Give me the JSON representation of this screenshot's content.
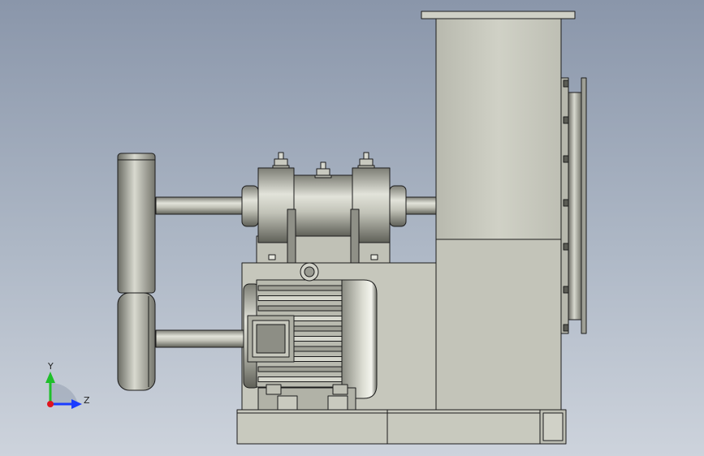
{
  "viewport": {
    "background_top": "#8a96aa",
    "background_bottom": "#cdd3dc"
  },
  "triad": {
    "y_label": "Y",
    "z_label": "Z",
    "y_color": "#1fbf2a",
    "z_color": "#1a3cff",
    "x_color": "#e0141e"
  },
  "model": {
    "body_color": "#c4c5ba",
    "edge_color": "#1c1c1c"
  }
}
